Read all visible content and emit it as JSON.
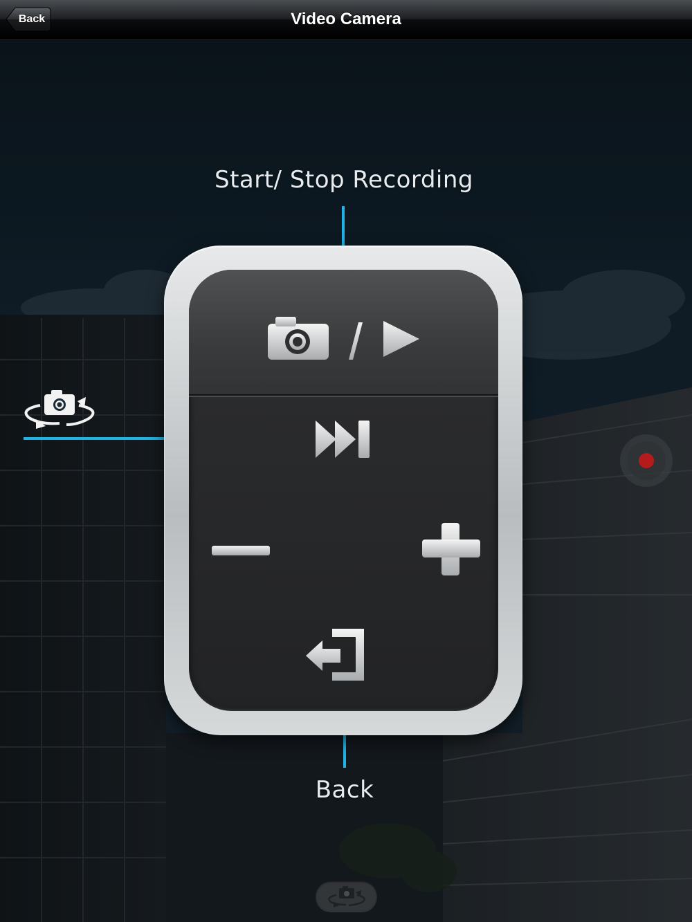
{
  "nav": {
    "title": "Video Camera",
    "back_label": "Back"
  },
  "help_overlay": {
    "start_stop_label": "Start/ Stop Recording",
    "back_label": "Back",
    "accent_color": "#1fb3e6"
  },
  "remote": {
    "buttons": [
      {
        "name": "camera-record-toggle",
        "icons": [
          "camera-icon",
          "play-icon"
        ]
      },
      {
        "name": "next",
        "icon": "skip-forward-icon"
      },
      {
        "name": "zoom-out",
        "icon": "minus-icon"
      },
      {
        "name": "zoom-in",
        "icon": "plus-icon"
      },
      {
        "name": "exit",
        "icon": "exit-icon"
      }
    ]
  },
  "indicators": {
    "record_light_color": "#b51b1b",
    "switch_camera_icon": "camera-switch-icon"
  }
}
